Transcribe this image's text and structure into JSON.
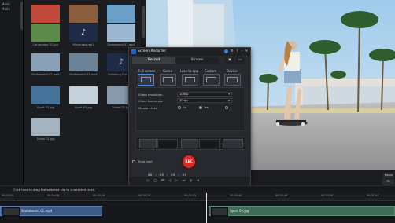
{
  "sidebar": {
    "items": [
      "Music",
      "Mode"
    ]
  },
  "library": {
    "items": [
      {
        "name": "Premium Media",
        "color": "#c14a3a"
      },
      {
        "name": "Food.jpg",
        "color": "#8a5e3c"
      },
      {
        "name": "Landscape 02.jpg",
        "color": "#6c9fc8"
      },
      {
        "name": "Landscape 01.jpg",
        "color": "#5b8a4a"
      },
      {
        "name": "Mahoroba.mp3",
        "color": "#1e2b47"
      },
      {
        "name": "Skateboard 01.mp4",
        "color": "#9bb6cf"
      },
      {
        "name": "Skateboard 02.mp4",
        "color": "#8aa0b7"
      },
      {
        "name": "Skateboard 03.mp4",
        "color": "#6c8297"
      },
      {
        "name": "Speaking Out.mp3",
        "color": "#1e2b47"
      },
      {
        "name": "Sport 01.jpg",
        "color": "#47739a"
      },
      {
        "name": "Sport 02.jpg",
        "color": "#c4d0da"
      },
      {
        "name": "Travel 02.jpg",
        "color": "#8899aa"
      },
      {
        "name": "Travel 01.jpg",
        "color": "#a5b3c0"
      }
    ]
  },
  "recorder": {
    "title": "Screen Recorder",
    "tabs": {
      "record": "Record",
      "stream": "Stream"
    },
    "modes": [
      "Full screen",
      "Game",
      "Lock to app",
      "Custom",
      "Device"
    ],
    "video_resolution_label": "Video resolution",
    "video_resolution_value": "1080p",
    "video_framerate_label": "Video framerate",
    "video_framerate_value": "30 fps",
    "mouse_clicks_label": "Mouse clicks",
    "mouse_clicks_no": "No",
    "mouse_clicks_yes": "Yes",
    "time_limit_label": "Time limit",
    "rec_label": "REC",
    "timecode": "00 : 00 : 00 : 00"
  },
  "preview": {
    "mode_label": "Movie",
    "zoom_value": "Fit"
  },
  "timeline": {
    "hint": "Click here to drag the selected clip to a selected track.",
    "ticks": [
      "00;00;00",
      "00;00;08",
      "00;00;16",
      "00;00;24",
      "00;00;32",
      "00;00;40",
      "00;00;48",
      "00;00;56",
      "00;01;04"
    ],
    "clips": [
      {
        "name": "Skateboard 01.mp4"
      },
      {
        "name": "Sport 02.jpg"
      }
    ]
  },
  "colors": {
    "accent": "#3c7ef0",
    "rec": "#d92a2a"
  }
}
